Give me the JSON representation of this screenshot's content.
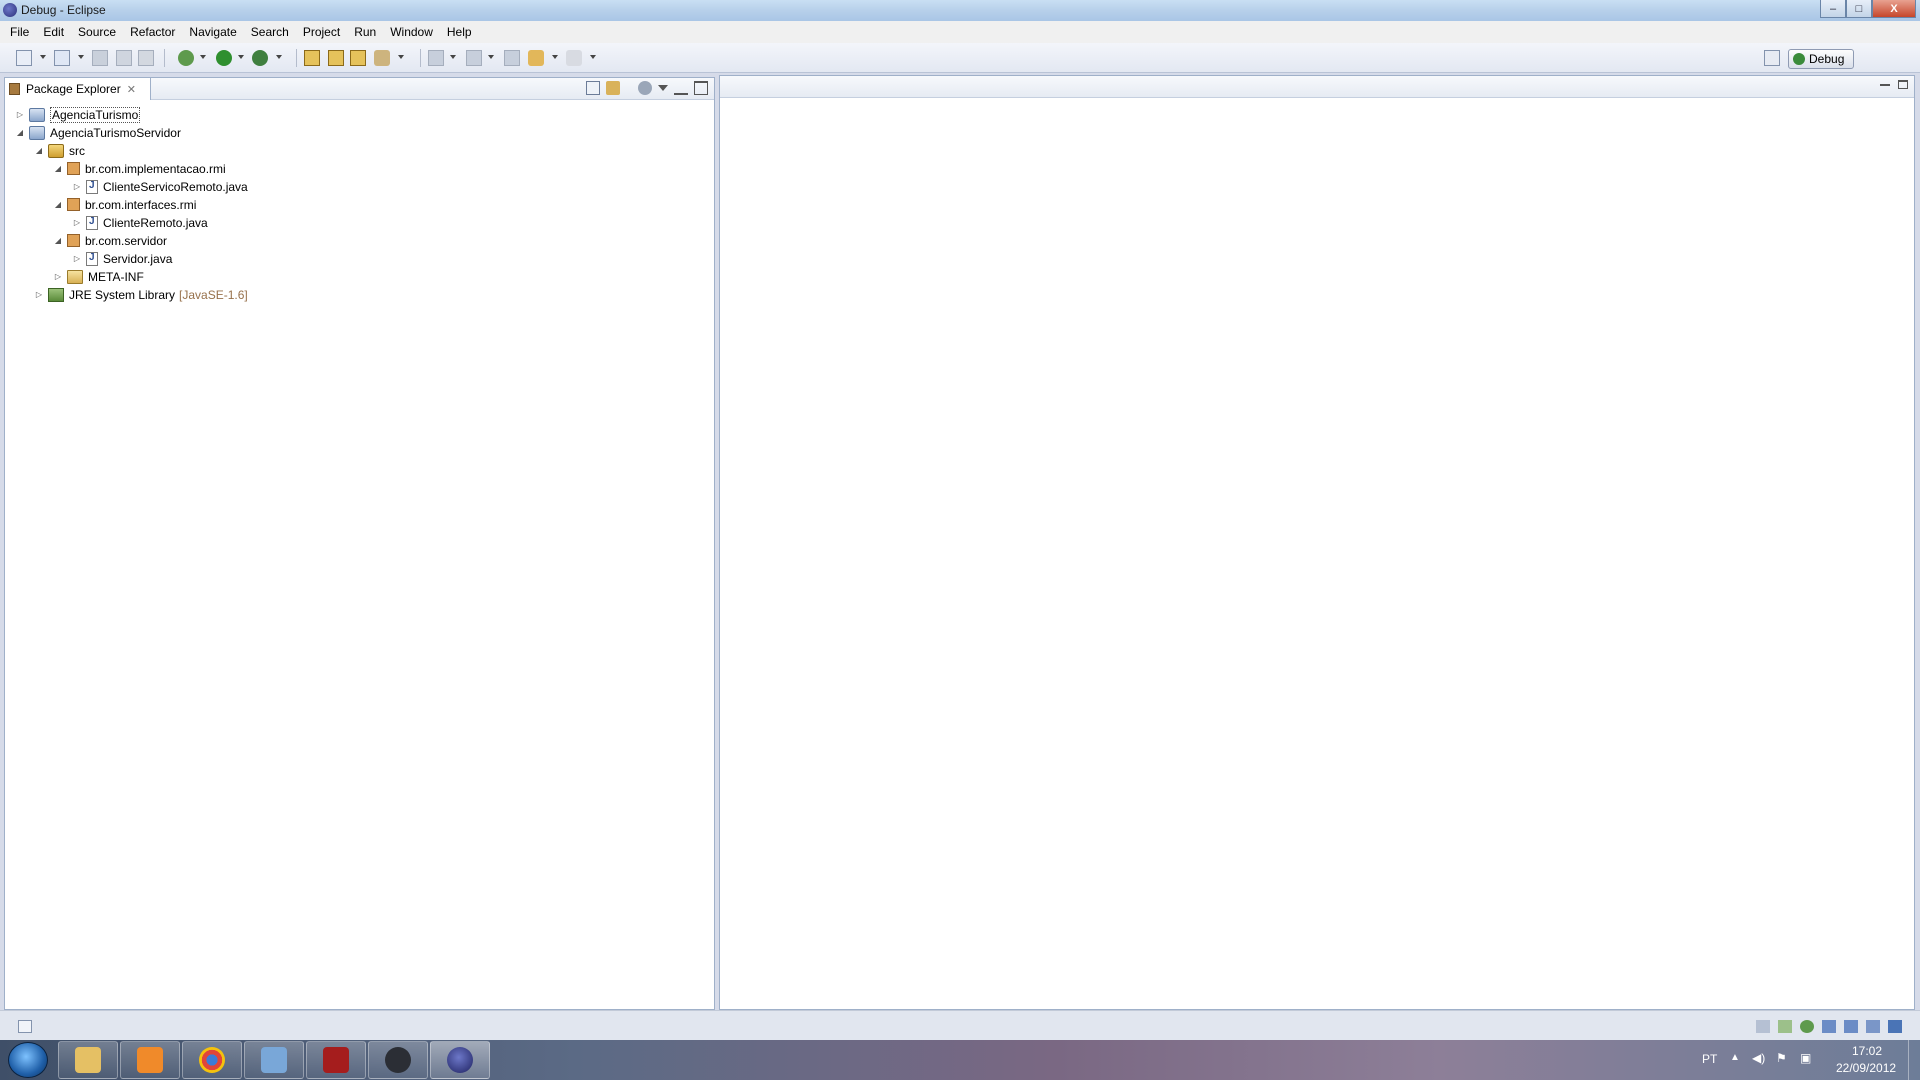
{
  "window": {
    "title": "Debug - Eclipse",
    "controls": {
      "minimize": "–",
      "maximize": "□",
      "close": "X"
    }
  },
  "menu": [
    {
      "label": "File",
      "mnemonic": "F",
      "rest": "ile"
    },
    {
      "label": "Edit",
      "mnemonic": "E",
      "rest": "dit"
    },
    {
      "label": "Source",
      "mnemonic": "S",
      "rest": "ource"
    },
    {
      "label": "Refactor",
      "mnemonic": "t",
      "rest": "Refactor"
    },
    {
      "label": "Navigate",
      "mnemonic": "N",
      "rest": "avigate"
    },
    {
      "label": "Search",
      "mnemonic": "a",
      "rest": "Search"
    },
    {
      "label": "Project",
      "mnemonic": "P",
      "rest": "roject"
    },
    {
      "label": "Run",
      "mnemonic": "R",
      "rest": "un"
    },
    {
      "label": "Window",
      "mnemonic": "W",
      "rest": "indow"
    },
    {
      "label": "Help",
      "mnemonic": "H",
      "rest": "elp"
    }
  ],
  "perspective": {
    "label": "Debug"
  },
  "package_explorer": {
    "tab_label": "Package Explorer",
    "close_glyph": "✕",
    "tree": [
      {
        "label": "AgenciaTurismo",
        "twisty": "▷",
        "icon": "project-icon"
      },
      {
        "label": "AgenciaTurismoServidor",
        "twisty": "◢",
        "icon": "project-icon"
      },
      {
        "label": "src",
        "twisty": "◢",
        "icon": "source-folder-icon"
      },
      {
        "label": "br.com.implementacao.rmi",
        "twisty": "◢",
        "icon": "package-icon"
      },
      {
        "label": "ClienteServicoRemoto.java",
        "twisty": "▷",
        "icon": "java-file-icon"
      },
      {
        "label": "br.com.interfaces.rmi",
        "twisty": "◢",
        "icon": "package-icon"
      },
      {
        "label": "ClienteRemoto.java",
        "twisty": "▷",
        "icon": "java-file-icon"
      },
      {
        "label": "br.com.servidor",
        "twisty": "◢",
        "icon": "package-icon"
      },
      {
        "label": "Servidor.java",
        "twisty": "▷",
        "icon": "java-file-icon"
      },
      {
        "label": "META-INF",
        "twisty": "▷",
        "icon": "folder-icon"
      },
      {
        "label": "JRE System Library",
        "suffix": "[JavaSE-1.6]",
        "twisty": "▷",
        "icon": "library-icon"
      }
    ]
  },
  "taskbar": {
    "language": "PT",
    "time": "17:02",
    "date": "22/09/2012",
    "apps": [
      "windows-explorer",
      "media-player",
      "chrome",
      "control-panel",
      "app-red",
      "steam",
      "eclipse"
    ]
  },
  "colors": {
    "accent": "#9fb0c9",
    "jre_suffix": "#97714b"
  }
}
